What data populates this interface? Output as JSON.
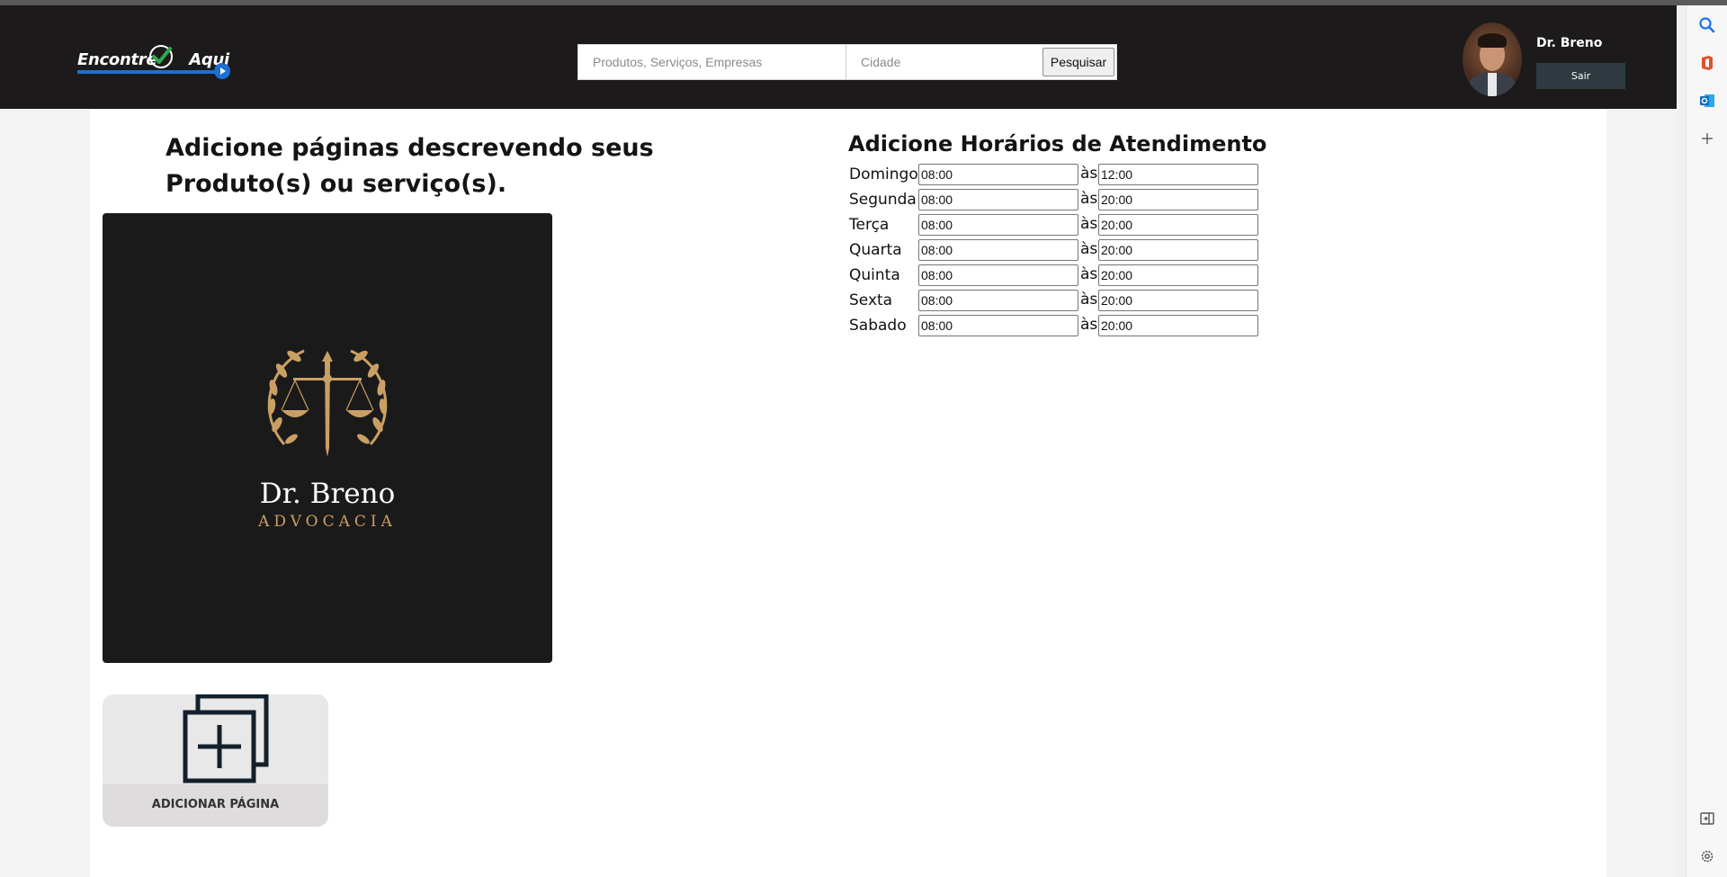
{
  "header": {
    "logo_text_1": "Encontre",
    "logo_text_2": "Aqui",
    "search": {
      "product_placeholder": "Produtos, Serviços, Empresas",
      "city_placeholder": "Cidade",
      "button_label": "Pesquisar"
    },
    "user": {
      "name": "Dr. Breno",
      "logout_label": "Sair"
    }
  },
  "pages": {
    "title": "Adicione páginas descrevendo seus Produto(s) ou serviço(s).",
    "card": {
      "brand_name": "Dr. Breno",
      "brand_sub": "ADVOCACIA"
    },
    "add_page_label": "ADICIONAR PÁGINA"
  },
  "hours": {
    "title": "Adicione Horários de Atendimento",
    "separator": "às",
    "days": [
      {
        "day": "Domingo",
        "from": "08:00",
        "to": "12:00"
      },
      {
        "day": "Segunda",
        "from": "08:00",
        "to": "20:00"
      },
      {
        "day": "Terça",
        "from": "08:00",
        "to": "20:00"
      },
      {
        "day": "Quarta",
        "from": "08:00",
        "to": "20:00"
      },
      {
        "day": "Quinta",
        "from": "08:00",
        "to": "20:00"
      },
      {
        "day": "Sexta",
        "from": "08:00",
        "to": "20:00"
      },
      {
        "day": "Sabado",
        "from": "08:00",
        "to": "20:00"
      }
    ]
  },
  "colors": {
    "header_bg": "#1c1a1a",
    "accent_blue": "#1d6fd1",
    "logo_gold": "#c9a064",
    "logout_bg": "#2e3a40"
  },
  "browser_sidebar": {
    "icons": [
      "search-icon",
      "office-icon",
      "outlook-icon",
      "plus-icon",
      "panel-icon",
      "gear-icon"
    ]
  }
}
